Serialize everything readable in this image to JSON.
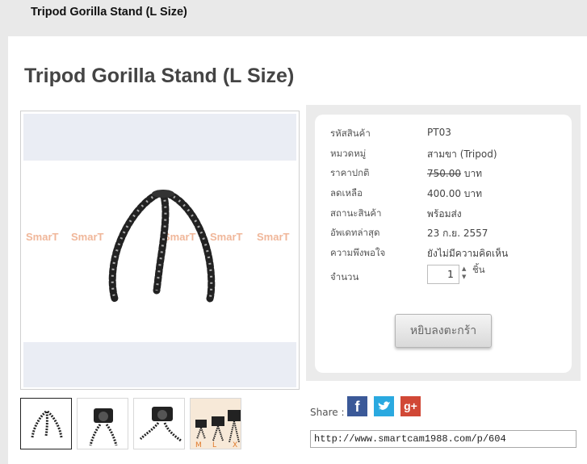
{
  "breadcrumb": "Tripod Gorilla Stand (L Size)",
  "product": {
    "title": "Tripod Gorilla Stand (L Size)",
    "watermark_brand": "SmarT",
    "watermark_sub": "smarT",
    "details": [
      {
        "label": "รหัสสินค้า",
        "value": "PT03"
      },
      {
        "label": "หมวดหมู่",
        "value": "สามขา (Tripod)"
      },
      {
        "label": "ราคาปกติ",
        "value": "750.00 บาท",
        "regular_amount": "750.00",
        "currency": "บาท"
      },
      {
        "label": "ลดเหลือ",
        "value": "400.00 บาท"
      },
      {
        "label": "สถานะสินค้า",
        "value": "พร้อมส่ง"
      },
      {
        "label": "อัพเดทล่าสุด",
        "value": "23 ก.ย. 2557"
      },
      {
        "label": "ความพึงพอใจ",
        "value": "ยังไม่มีความคิดเห็น"
      }
    ],
    "quantity_label": "จำนวน",
    "quantity_value": "1",
    "quantity_unit": "ชิ้น",
    "add_to_cart": "หยิบลงตะกร้า",
    "thumbnail_size_labels": [
      "M",
      "L",
      "X"
    ]
  },
  "share": {
    "label": "Share :",
    "icons": [
      "facebook-icon",
      "twitter-icon",
      "google-plus-icon"
    ],
    "url": "http://www.smartcam1988.com/p/604"
  },
  "colors": {
    "facebook": "#3b5998",
    "twitter": "#2aa9e0",
    "google_plus": "#d14836",
    "page_bg": "#e9e9e9"
  }
}
